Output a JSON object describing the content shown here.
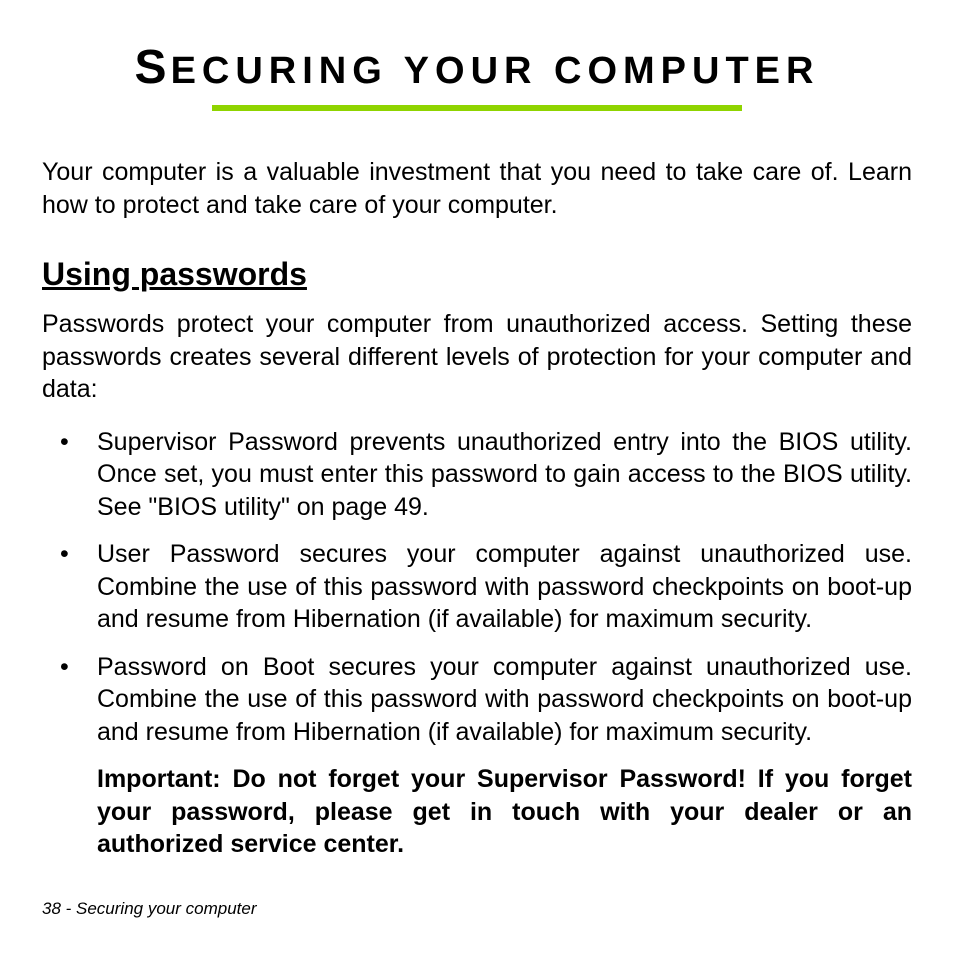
{
  "title": {
    "firstChar": "S",
    "rest": "ECURING YOUR COMPUTER"
  },
  "intro": "Your computer is a valuable investment that you need to take care of. Learn how to protect and take care of your computer.",
  "section": {
    "heading": "Using passwords",
    "intro": "Passwords protect your computer from unauthorized access. Setting these passwords creates several different levels of protection for your computer and data:",
    "bullets": [
      "Supervisor Password prevents unauthorized entry into the BIOS utility. Once set, you must enter this password to gain access to the BIOS utility. See \"BIOS utility\" on page 49.",
      "User Password secures your computer against unauthorized use. Combine the use of this password with password checkpoints on boot-up and resume from Hibernation (if available) for maximum security.",
      "Password on Boot secures your computer against unauthorized use. Combine the use of this password with password checkpoints on boot-up and resume from Hibernation (if available) for maximum security."
    ],
    "important": "Important: Do not forget your Supervisor Password! If you forget your password, please get in touch with your dealer or an authorized service center."
  },
  "footer": "38 - Securing your computer"
}
